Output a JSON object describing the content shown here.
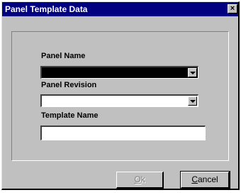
{
  "window": {
    "title": "Panel Template Data",
    "close_glyph": "×"
  },
  "form": {
    "panel_name_label": "Panel Name",
    "panel_name_value": "",
    "panel_revision_label": "Panel Revision",
    "panel_revision_value": "",
    "template_name_label": "Template Name",
    "template_name_value": ""
  },
  "buttons": {
    "ok": {
      "mnemonic": "O",
      "rest": "k",
      "enabled": false
    },
    "cancel": {
      "mnemonic": "C",
      "rest": "ancel",
      "enabled": true
    }
  },
  "colors": {
    "titlebar": "#000080",
    "face": "#c0c0c0",
    "selected_field": "#000000"
  }
}
